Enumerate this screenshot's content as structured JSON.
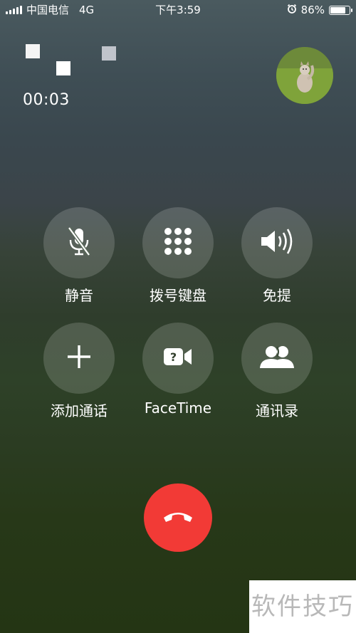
{
  "status_bar": {
    "carrier": "中国电信",
    "network": "4G",
    "time": "下午3:59",
    "battery_percent": "86%",
    "battery_level": 0.86,
    "icons": [
      "signal-icon",
      "alarm-icon",
      "battery-icon"
    ]
  },
  "call": {
    "duration": "00:03"
  },
  "controls": [
    {
      "label": "静音",
      "icon": "mute-icon"
    },
    {
      "label": "拨号键盘",
      "icon": "keypad-icon"
    },
    {
      "label": "免提",
      "icon": "speaker-icon"
    },
    {
      "label": "添加通话",
      "icon": "add-call-icon"
    },
    {
      "label": "FaceTime",
      "icon": "facetime-icon"
    },
    {
      "label": "通讯录",
      "icon": "contacts-icon"
    }
  ],
  "end_call": {
    "icon": "hang-up-icon",
    "color": "#f23a36"
  },
  "watermark": {
    "text": "软件技巧"
  }
}
